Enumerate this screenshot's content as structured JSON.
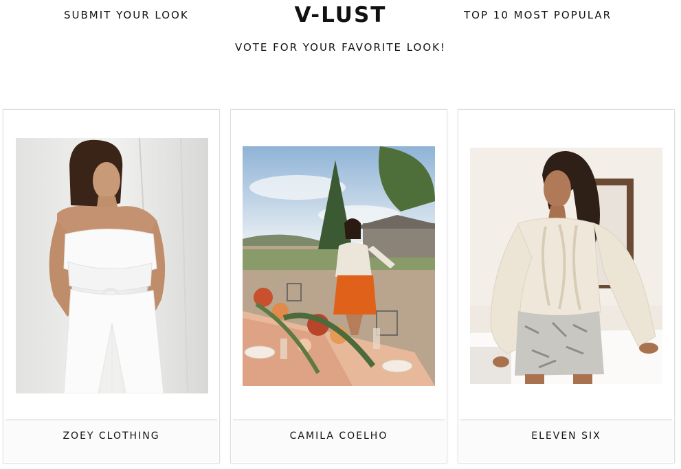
{
  "header": {
    "nav_left": "SUBMIT YOUR LOOK",
    "logo": "V-LUST",
    "nav_right": "TOP 10 MOST POPULAR",
    "subtitle": "VOTE FOR YOUR FAVORITE LOOK!"
  },
  "cards": [
    {
      "label": "ZOEY CLOTHING",
      "photo": "woman in white strapless ruffle jumpsuit against white wall"
    },
    {
      "label": "CAMILA COELHO",
      "photo": "woman in white blouse and orange skirt at outdoor dinner table"
    },
    {
      "label": "ELEVEN SIX",
      "photo": "woman in cream cable-knit sweater and snakeskin skirt"
    }
  ],
  "colors": {
    "text": "#111111",
    "card_border": "#dedede",
    "background": "#ffffff"
  }
}
